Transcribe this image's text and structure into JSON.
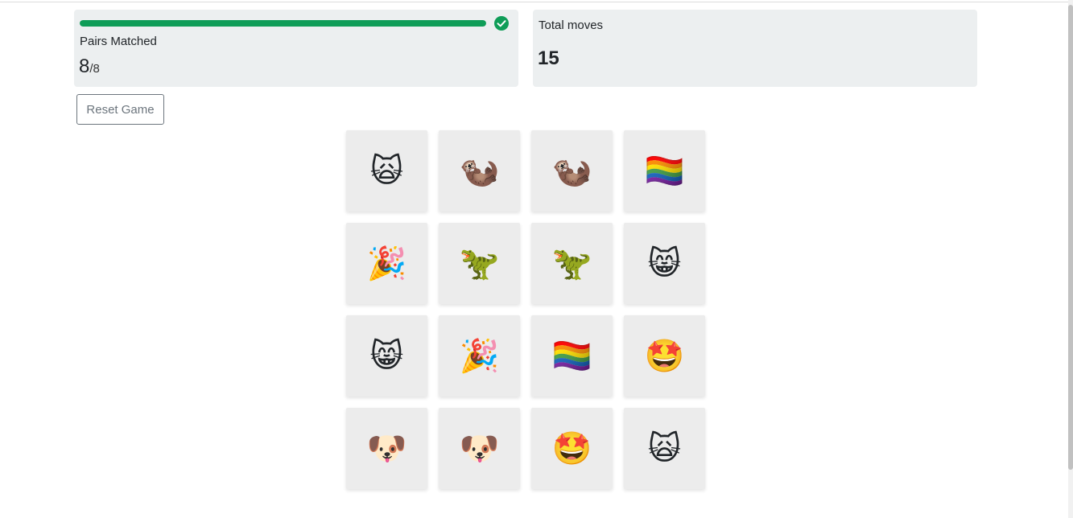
{
  "stats": {
    "pairs_label": "Pairs Matched",
    "pairs_matched": "8",
    "pairs_total": "/8",
    "progress_fraction": 1.0,
    "moves_label": "Total moves",
    "moves_value": "15"
  },
  "controls": {
    "reset_label": "Reset Game"
  },
  "colors": {
    "progress": "#0f9d58",
    "card_bg": "#eceff0",
    "tile_bg": "#ececec"
  },
  "board": {
    "rows": 4,
    "cols": 4,
    "tiles": [
      {
        "icon": "scream-cat-icon",
        "glyph": "🙀"
      },
      {
        "icon": "otter-icon",
        "glyph": "🦦"
      },
      {
        "icon": "otter-icon",
        "glyph": "🦦"
      },
      {
        "icon": "rainbow-flag-icon",
        "glyph": "🏳️‍🌈"
      },
      {
        "icon": "party-popper-icon",
        "glyph": "🎉"
      },
      {
        "icon": "t-rex-icon",
        "glyph": "🦖"
      },
      {
        "icon": "t-rex-icon",
        "glyph": "🦖"
      },
      {
        "icon": "grinning-cat-icon",
        "glyph": "😸"
      },
      {
        "icon": "grinning-cat-icon",
        "glyph": "😸"
      },
      {
        "icon": "party-popper-icon",
        "glyph": "🎉"
      },
      {
        "icon": "rainbow-flag-icon",
        "glyph": "🏳️‍🌈"
      },
      {
        "icon": "star-struck-icon",
        "glyph": "🤩"
      },
      {
        "icon": "dog-face-icon",
        "glyph": "🐶"
      },
      {
        "icon": "dog-face-icon",
        "glyph": "🐶"
      },
      {
        "icon": "star-struck-icon",
        "glyph": "🤩"
      },
      {
        "icon": "scream-cat-icon",
        "glyph": "🙀"
      }
    ]
  }
}
